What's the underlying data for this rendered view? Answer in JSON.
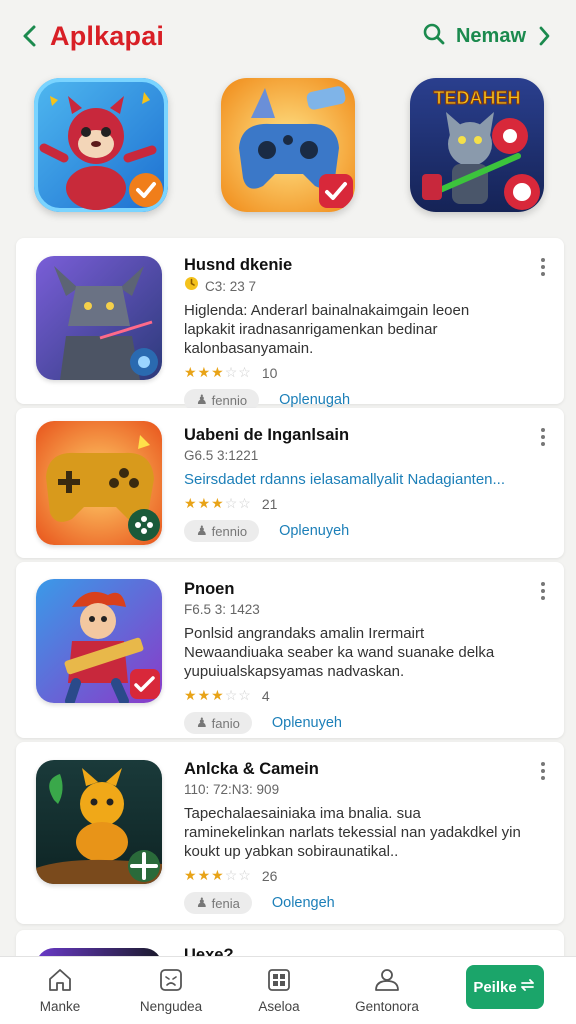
{
  "header": {
    "title": "Aplkapai",
    "search_label": "Nemaw"
  },
  "featured": [
    {
      "icon": "squirrel-game-icon",
      "badge": "check-badge"
    },
    {
      "icon": "controller-game-icon",
      "badge": "check-badge"
    },
    {
      "icon": "cat-warrior-game-icon",
      "badge": "progress-badge",
      "art_text": "TEDAHEH"
    }
  ],
  "apps": [
    {
      "name": "Husnd dkenie",
      "meta": "C3: 23 7",
      "meta_icon": "clock-icon",
      "desc": "Higlenda: Anderarl bainalnakaimgain leoen lapkakit iradnasanrigamenkan bedinar kalonbasanyamain.",
      "desc_link": false,
      "rating": 3,
      "count": "10",
      "chip": "fennio",
      "open": "Oplenugah"
    },
    {
      "name": "Uabeni de Inganlsain",
      "meta": "G6.5 3:1221",
      "desc": "Seirsdadet rdanns ielasamallyalit Nadagianten...",
      "desc_link": true,
      "rating": 3,
      "count": "21",
      "chip": "fennio",
      "open": "Oplenuyeh"
    },
    {
      "name": "Pnoen",
      "meta": "F6.5 3: 1423",
      "desc": "Ponlsid angrandaks amalin Irermairt Newaandiuaka seaber ka wand suanake delka yupuiualskapsyamas nadvaskan.",
      "desc_link": false,
      "rating": 3,
      "count": "4",
      "chip": "fanio",
      "open": "Oplenuyeh"
    },
    {
      "name": "Anlcka & Camein",
      "meta": "110: 72:N3: 909",
      "desc": "Tapechalaesainiaka ima bnalia. sua raminekelinkan narlats tekessial nan yadakdkel yin koukt up yabkan sobiraunatikal..",
      "desc_link": false,
      "rating": 3,
      "count": "26",
      "chip": "fenia",
      "open": "Oolengeh"
    },
    {
      "name": "Uexe?"
    }
  ],
  "nav": [
    {
      "label": "Manke",
      "icon": "home-icon"
    },
    {
      "label": "Nengudea",
      "icon": "face-icon"
    },
    {
      "label": "Aseloa",
      "icon": "grid-icon"
    },
    {
      "label": "Gentonora",
      "icon": "person-icon"
    }
  ],
  "cta": {
    "label": "Peilke",
    "icon": "arrow-right-icon"
  },
  "colors": {
    "title": "#d81f26",
    "accent_green": "#1b8a4e",
    "cta_green": "#1ba56a",
    "link_blue": "#1c7fb8",
    "star": "#e8a317"
  }
}
